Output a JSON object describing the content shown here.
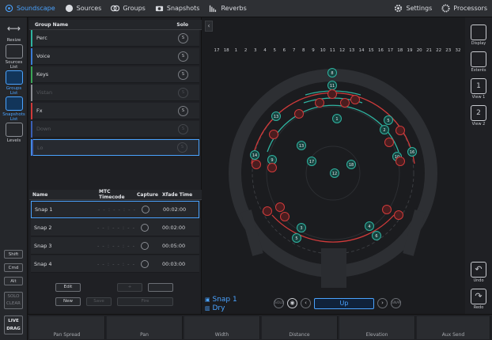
{
  "topbar": {
    "soundscape": "Soundscape",
    "sources": "Sources",
    "groups": "Groups",
    "snapshots": "Snapshots",
    "reverbs": "Reverbs",
    "settings": "Settings",
    "processors": "Processors"
  },
  "leftbar": {
    "resize": "Resize",
    "sources_list": "Sources List",
    "groups_list": "Groups List",
    "snapshots_list": "Snapshots List",
    "levels": "Levels",
    "shift": "Shift",
    "cmd": "Cmd",
    "alt": "Alt",
    "solo_clear_1": "SOLO",
    "solo_clear_2": "CLEAR",
    "live_drag_1": "LIVE",
    "live_drag_2": "DRAG"
  },
  "groups_table": {
    "col_name": "Group Name",
    "col_solo": "Solo",
    "solo_label": "S",
    "rows": [
      {
        "name": "Perc",
        "color": "#2fb3a0",
        "dim": false
      },
      {
        "name": "Voice",
        "color": "#3a7bd5",
        "dim": false
      },
      {
        "name": "Keys",
        "color": "#3aa457",
        "dim": false
      },
      {
        "name": "Vistan",
        "color": "#8a8d93",
        "dim": true
      },
      {
        "name": "Fx",
        "color": "#d03a3a",
        "dim": false
      },
      {
        "name": "Down",
        "color": "#3a5fb5",
        "dim": true
      },
      {
        "name": "Lo",
        "color": "#3a5fb5",
        "dim": true
      }
    ]
  },
  "snapshots_table": {
    "col_name": "Name",
    "col_mtc": "MTC Timecode",
    "col_capture": "Capture",
    "col_xfade": "Xfade Time",
    "rows": [
      {
        "name": "Snap 1",
        "tc": "- - : - - : - -",
        "xfade": "00:02:00"
      },
      {
        "name": "Snap 2",
        "tc": "- - : - - : - -",
        "xfade": "00:02:00"
      },
      {
        "name": "Snap 3",
        "tc": "- - : - - : - -",
        "xfade": "00:05:00"
      },
      {
        "name": "Snap 4",
        "tc": "- - : - - : - -",
        "xfade": "00:03:00"
      }
    ]
  },
  "panel_buttons": {
    "edit": "Edit",
    "new": "New",
    "save": "Save",
    "fire": "Fire",
    "plus": "+"
  },
  "stage": {
    "speaker_numbers": [
      "17",
      "18",
      "1",
      "2",
      "3",
      "4",
      "5",
      "6",
      "7",
      "8",
      "9",
      "10",
      "11",
      "12",
      "13",
      "14",
      "15",
      "16",
      "17",
      "18",
      "19",
      "20",
      "21",
      "22",
      "23",
      "32"
    ],
    "snap_name": "Snap 1",
    "dry_label": "Dry",
    "view_label": "Up",
    "solo_label": "SOLO",
    "snap_label": "SNAP"
  },
  "rightbar": {
    "display": "Display",
    "extents": "Extents",
    "view1": "View 1",
    "view2": "View 2",
    "undo": "Undo",
    "redo": "Redo"
  },
  "bottom": {
    "labels": [
      "Pan Spread",
      "Pan",
      "Width",
      "Distance",
      "Elevation",
      "Aux Send"
    ]
  },
  "colors": {
    "accent": "#4aa3ff",
    "teal": "#2fb3a0",
    "red": "#d03a3a"
  }
}
